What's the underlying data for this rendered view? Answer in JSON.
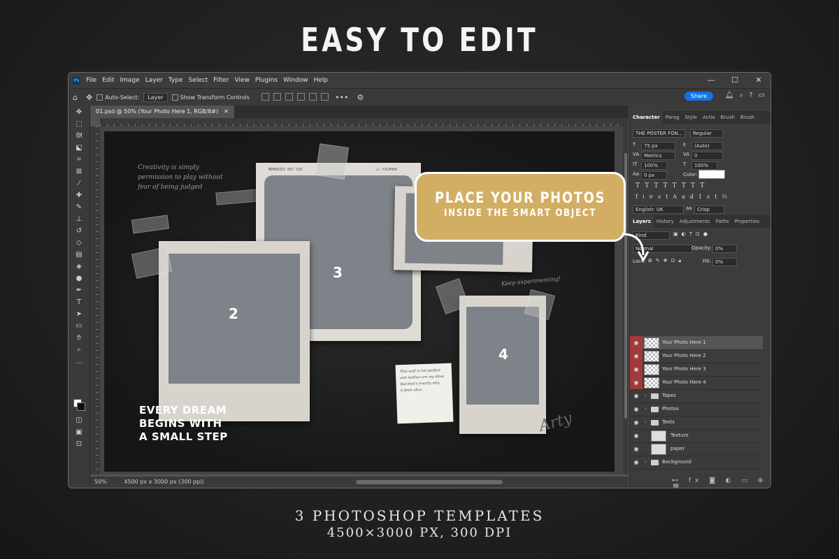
{
  "headline": "EASY TO EDIT",
  "footer": {
    "line1": "3 PHOTOSHOP TEMPLATES",
    "line2": "4500×3000 PX, 300 DPI"
  },
  "menu": [
    "File",
    "Edit",
    "Image",
    "Layer",
    "Type",
    "Select",
    "Filter",
    "View",
    "Plugins",
    "Window",
    "Help"
  ],
  "window_controls": [
    "—",
    "☐",
    "✕"
  ],
  "options": {
    "auto_select": "Auto-Select:",
    "layer_select": "Layer",
    "show_transform": "Show Transform Controls",
    "share": "Share"
  },
  "doc_tab": "01.psd @ 50% (Your Photo Here 1, RGB/8#)",
  "status": {
    "zoom": "50%",
    "doc_size": "4500 px x 3000 px (300 ppi)"
  },
  "canvas": {
    "quote": [
      "Creativity is simply",
      "permission to play without",
      "fear of being judged"
    ],
    "dream": [
      "EVERY DREAM",
      "BEGINS WITH",
      "A SMALL STEP"
    ],
    "keep": "Keep experimenting!",
    "note": [
      "This wall is not perfect",
      "and neither are my ideas",
      "But that's exactly why",
      "it feels alive."
    ],
    "film_left": "MEMORIES 007-158",
    "film_right": "▷▷ FILM400",
    "photo_labels": [
      "2",
      "3",
      "4"
    ],
    "signature": "Arty"
  },
  "callout": {
    "line1": "PLACE YOUR PHOTOS",
    "line2": "INSIDE THE SMART OBJECT"
  },
  "char_panel": {
    "tabs": [
      "Character",
      "Parag",
      "Style",
      "Actio",
      "Brush",
      "Brush"
    ],
    "font": "THE POSTER FON...",
    "style": "Regular",
    "size": "75 px",
    "leading": "(Auto)",
    "kerning": "Metrics",
    "tracking": "0",
    "vscale": "100%",
    "hscale": "100%",
    "baseline": "0 px",
    "color_label": "Color:",
    "lang": "English: UK",
    "aa_label": "aa",
    "aa": "Crisp"
  },
  "layers_panel": {
    "tabs": [
      "Layers",
      "History",
      "Adjustments",
      "Paths",
      "Properties"
    ],
    "kind": "Kind",
    "blend": "Normal",
    "opacity_label": "Opacity:",
    "opacity": "0%",
    "lock_label": "Lock:",
    "fill_label": "Fill:",
    "fill": "0%",
    "layers": [
      {
        "name": "Your Photo Here 1",
        "type": "so",
        "red": true
      },
      {
        "name": "Your Photo Here 2",
        "type": "so",
        "red": true
      },
      {
        "name": "Your Photo Here 3",
        "type": "so",
        "red": true
      },
      {
        "name": "Your Photo Here 4",
        "type": "so",
        "red": true
      },
      {
        "name": "Tapes",
        "type": "folder",
        "red": false
      },
      {
        "name": "Photos",
        "type": "folder",
        "red": false
      },
      {
        "name": "Texts",
        "type": "folder",
        "red": false
      },
      {
        "name": "Texture",
        "type": "img",
        "red": false
      },
      {
        "name": "paper",
        "type": "img",
        "red": false
      },
      {
        "name": "Background",
        "type": "folder",
        "red": false
      }
    ]
  },
  "colors": {
    "callout": "#d2ae64",
    "accent": "#1473e6",
    "layer_red": "#a33a3a"
  }
}
